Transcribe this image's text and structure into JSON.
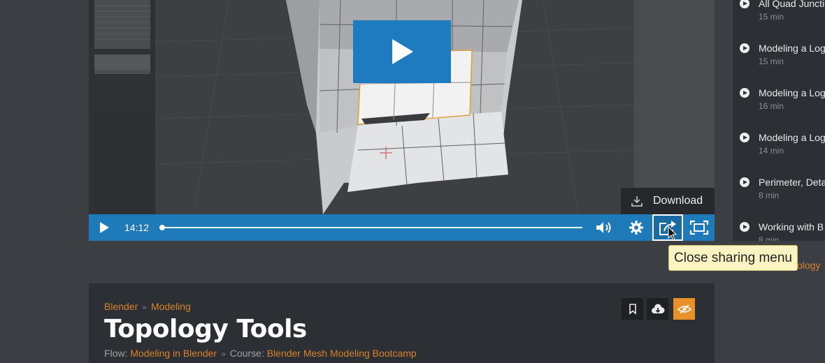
{
  "player": {
    "current_time": "14:12",
    "download_label": "Download",
    "tooltip": "Close sharing menu",
    "progress_fraction": 0.0,
    "accent_color": "#1f7ab9",
    "big_play_color": "#1e7bbf"
  },
  "playlist": {
    "items": [
      {
        "title": "All Quad Junctions",
        "duration": "15 min"
      },
      {
        "title": "Modeling a Log",
        "duration": "15 min"
      },
      {
        "title": "Modeling a Log",
        "duration": "16 min"
      },
      {
        "title": "Modeling a Log",
        "duration": "14 min"
      },
      {
        "title": "Perimeter, Deta",
        "duration": "8 min"
      },
      {
        "title": "Working with B",
        "duration": "8 min"
      }
    ],
    "partial_link_text": "ology"
  },
  "lesson": {
    "breadcrumb": [
      "Blender",
      "Modeling"
    ],
    "breadcrumb_separator": "»",
    "title": "Topology Tools",
    "flow_label": "Flow:",
    "flow_value": "Modeling in Blender",
    "course_label": "Course:",
    "course_value": "Blender Mesh Modeling Bootcamp",
    "link_color": "#d9822b"
  },
  "icons": {
    "big_play": "play-icon",
    "play": "play-icon",
    "volume": "volume-icon",
    "settings": "gear-icon",
    "share": "share-icon",
    "fullscreen": "fullscreen-icon",
    "download": "download-icon",
    "bookmark": "bookmark-icon",
    "cloud_download": "cloud-download-icon",
    "hide": "eye-slash-icon"
  }
}
